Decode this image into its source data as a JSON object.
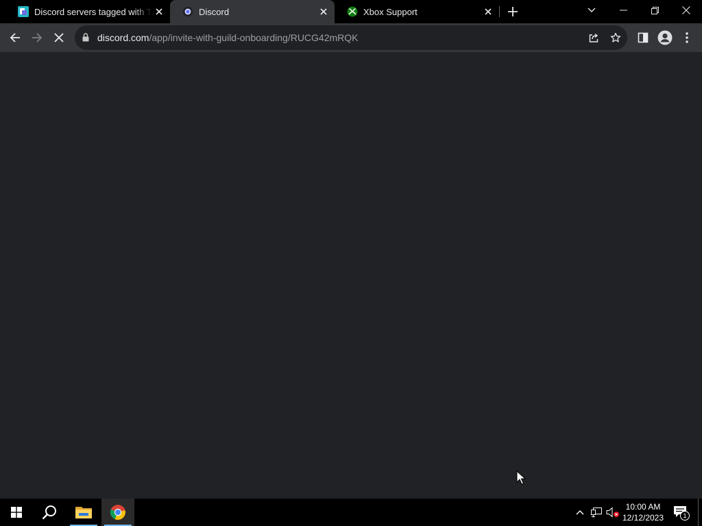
{
  "browser": {
    "tabs": [
      {
        "title": "Discord servers tagged with Test",
        "favicon": "disboard-favicon",
        "active": false
      },
      {
        "title": "Discord",
        "favicon": "discord-favicon",
        "active": true
      },
      {
        "title": "Xbox Support",
        "favicon": "xbox-favicon",
        "active": false
      }
    ],
    "address_bar": {
      "domain": "discord.com",
      "path": "/app/invite-with-guild-onboarding/RUCG42mRQK"
    },
    "loading": true
  },
  "taskbar": {
    "pinned": [
      "start-icon",
      "search-icon",
      "file-explorer-icon",
      "chrome-icon"
    ],
    "clock": {
      "time": "10:00 AM",
      "date": "12/12/2023"
    },
    "notification_count": "1"
  },
  "colors": {
    "content_bg": "#202225",
    "toolbar_bg": "#35363a",
    "tabstrip_bg": "#000000",
    "taskbar_accent": "#76b9ed"
  }
}
